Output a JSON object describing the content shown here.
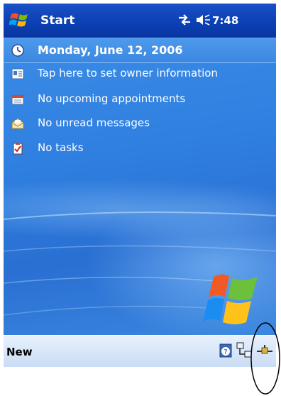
{
  "titlebar": {
    "app_title": "Start",
    "time": "7:48",
    "icons": [
      "windows-start-icon",
      "connectivity-icon",
      "speaker-icon"
    ]
  },
  "today": {
    "date": "Monday, June 12, 2006",
    "items": [
      {
        "label": "Tap here to set owner information",
        "icon": "owner-card-icon"
      },
      {
        "label": "No upcoming appointments",
        "icon": "calendar-icon"
      },
      {
        "label": "No unread messages",
        "icon": "envelope-icon"
      },
      {
        "label": "No tasks",
        "icon": "tasks-clipboard-icon"
      }
    ]
  },
  "bottombar": {
    "new_label": "New",
    "icons": [
      "help-icon",
      "network-icon",
      "usb-plug-icon"
    ]
  },
  "colors": {
    "titlebar": "#0b3fb2",
    "today_background": "#2e7fe0",
    "bottombar": "#c9dcf4",
    "annotation": "#000000"
  }
}
